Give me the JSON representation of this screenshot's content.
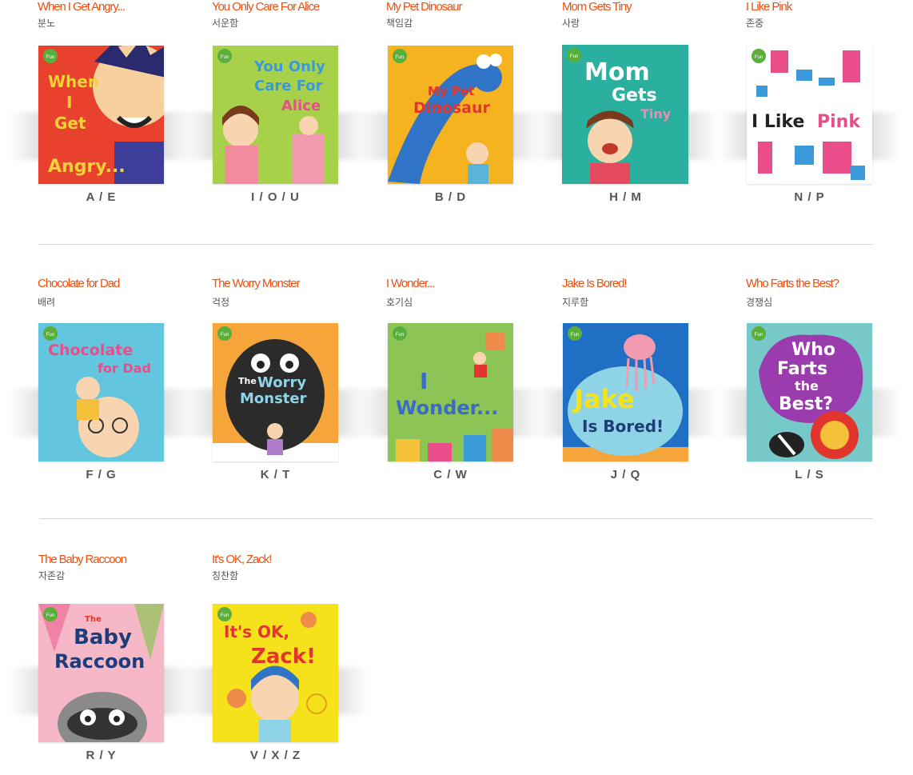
{
  "books": [
    {
      "title": "When I Get Angry...",
      "theme": "분노",
      "codes": "A / E",
      "cover_text": [
        "When",
        "I",
        "Get",
        "Angry..."
      ],
      "cover_color": "#e8412d"
    },
    {
      "title": "You Only Care For Alice",
      "theme": "서운함",
      "codes": "I / O / U",
      "cover_text": [
        "You Only",
        "Care For",
        "Alice"
      ],
      "cover_color": "#9ccb3a"
    },
    {
      "title": "My Pet Dinosaur",
      "theme": "책임감",
      "codes": "B / D",
      "cover_text": [
        "My Pet",
        "Dinosaur"
      ],
      "cover_color": "#f5b320"
    },
    {
      "title": "Mom Gets Tiny",
      "theme": "사랑",
      "codes": "H / M",
      "cover_text": [
        "Mom",
        "Gets",
        "Tiny"
      ],
      "cover_color": "#2bb0a0"
    },
    {
      "title": "I Like Pink",
      "theme": "존중",
      "codes": "N / P",
      "cover_text": [
        "I Like",
        "Pink"
      ],
      "cover_color": "#ffffff"
    },
    {
      "title": "Chocolate for Dad",
      "theme": "배려",
      "codes": "F / G",
      "cover_text": [
        "Chocolate",
        "for Dad"
      ],
      "cover_color": "#63c6de"
    },
    {
      "title": "The Worry Monster",
      "theme": "걱정",
      "codes": "K / T",
      "cover_text": [
        "The",
        "Worry",
        "Monster"
      ],
      "cover_color": "#f5a53a"
    },
    {
      "title": "I Wonder...",
      "theme": "호기심",
      "codes": "C / W",
      "cover_text": [
        "I",
        "Wonder..."
      ],
      "cover_color": "#8cc455"
    },
    {
      "title": "Jake Is Bored!",
      "theme": "지루함",
      "codes": "J / Q",
      "cover_text": [
        "Jake",
        "Is Bored!"
      ],
      "cover_color": "#1f6fc4"
    },
    {
      "title": "Who Farts the Best?",
      "theme": "경쟁심",
      "codes": "L / S",
      "cover_text": [
        "Who",
        "Farts",
        "the",
        "Best?"
      ],
      "cover_color": "#77c9c9"
    },
    {
      "title": "The Baby Raccoon",
      "theme": "자존감",
      "codes": "R / Y",
      "cover_text": [
        "The",
        "Baby",
        "Raccoon"
      ],
      "cover_color": "#f6b7c6"
    },
    {
      "title": "It's OK, Zack!",
      "theme": "칭찬함",
      "codes": "V / X / Z",
      "cover_text": [
        "It's OK,",
        "Zack!"
      ],
      "cover_color": "#f6e21b"
    }
  ],
  "badge_text": "Fun"
}
